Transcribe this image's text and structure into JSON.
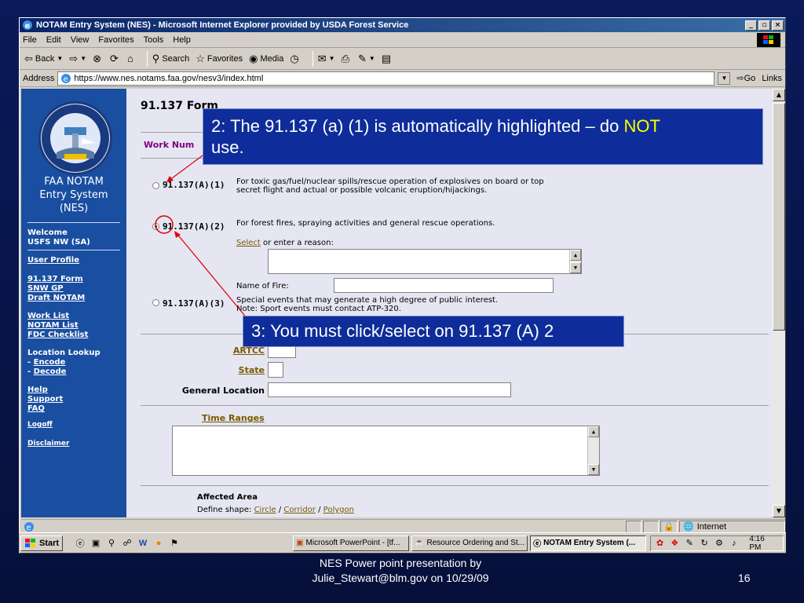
{
  "window": {
    "title": "NOTAM Entry System (NES) - Microsoft Internet Explorer provided by USDA Forest Service",
    "minimize": "_",
    "maximize": "▫",
    "close": "×"
  },
  "menu": [
    "File",
    "Edit",
    "View",
    "Favorites",
    "Tools",
    "Help"
  ],
  "toolbar": {
    "back": "Back",
    "search": "Search",
    "favorites": "Favorites",
    "media": "Media"
  },
  "address": {
    "label": "Address",
    "url": "https://www.nes.notams.faa.gov/nesv3/index.html",
    "go": "Go",
    "links": "Links"
  },
  "sidebar": {
    "system_name_1": "FAA NOTAM",
    "system_name_2": "Entry System",
    "system_name_3": "(NES)",
    "welcome": "Welcome",
    "user": "USFS NW (SA)",
    "user_profile": "User Profile",
    "form_91137": "91.137 Form",
    "snw_gp": "SNW GP",
    "draft_notam": "Draft NOTAM",
    "work_list": "Work List",
    "notam_list": "NOTAM List",
    "fdc_checklist": "FDC Checklist",
    "location_lookup": "Location Lookup",
    "encode": "Encode",
    "decode": "Decode",
    "dash": "-",
    "help": "Help",
    "support": "Support",
    "faq": "FAQ",
    "logoff": "Logoff",
    "disclaimer": "Disclaimer"
  },
  "form": {
    "title": "91.137 Form",
    "work_number": "Work Num",
    "opt1_label": "91.137(A)(1)",
    "opt1_desc": "For toxic gas/fuel/nuclear spills/rescue operation of explosives on board or top secret flight and actual or possible volcanic eruption/hijackings.",
    "opt2_label": "91.137(A)(2)",
    "opt2_desc": "For forest fires, spraying activities and general rescue operations.",
    "select_link": "Select",
    "reason_text": " or enter a reason:",
    "name_of_fire": "Name of Fire:",
    "opt3_label": "91.137(A)(3)",
    "opt3_desc_1": "Special events that may generate a high degree of public interest.",
    "opt3_desc_2": "Note: Sport events must contact ATP-320.",
    "artcc": "ARTCC",
    "state": "State",
    "general_location": "General Location",
    "time_ranges": "Time Ranges",
    "affected_area": "Affected Area",
    "define_shape": "Define shape:",
    "circle": "Circle",
    "corridor": "Corridor",
    "polygon": "Polygon",
    "slash": "/"
  },
  "status": {
    "zone": "Internet"
  },
  "taskbar": {
    "start": "Start",
    "task1": "Microsoft PowerPoint - [tf...",
    "task2": "Resource Ordering and St...",
    "task3": "NOTAM Entry System (...",
    "clock": "4:16 PM"
  },
  "callouts": {
    "c2_text": "2: The 91.137 (a) (1) is automatically highlighted – do ",
    "c2_hl": "NOT",
    "c2_end": "use.",
    "c3_text": "3: You must click/select on 91.137 (A) 2"
  },
  "footer": {
    "line1": "NES Power point presentation by",
    "line2": "Julie_Stewart@blm.gov on 10/29/09",
    "page": "16"
  },
  "colors": {
    "slide_bg": "#0a1a5a",
    "callout_bg": "#0e2d9a",
    "callout_highlight": "#ffff00",
    "sidebar_bg": "#1a4ea0",
    "form_bg": "#e5e6f2",
    "annotation_red": "#e00000"
  }
}
